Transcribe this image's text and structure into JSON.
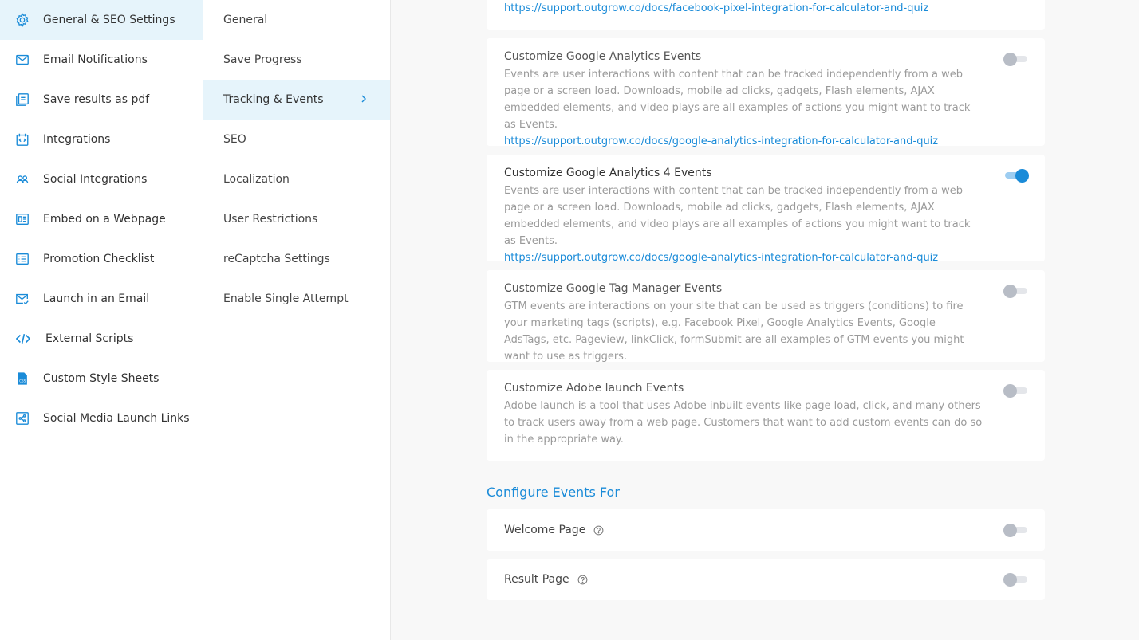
{
  "sidebar": {
    "items": [
      {
        "label": "General & SEO Settings",
        "icon": "gear-icon"
      },
      {
        "label": "Email Notifications",
        "icon": "envelope-icon"
      },
      {
        "label": "Save results as pdf",
        "icon": "pdf-icon"
      },
      {
        "label": "Integrations",
        "icon": "integrations-icon"
      },
      {
        "label": "Social Integrations",
        "icon": "users-icon"
      },
      {
        "label": "Embed on a Webpage",
        "icon": "embed-icon"
      },
      {
        "label": "Promotion Checklist",
        "icon": "checklist-icon"
      },
      {
        "label": "Launch in an Email",
        "icon": "email-check-icon"
      },
      {
        "label": "External Scripts",
        "icon": "code-icon"
      },
      {
        "label": "Custom Style Sheets",
        "icon": "css-file-icon"
      },
      {
        "label": "Social Media Launch Links",
        "icon": "share-icon"
      }
    ]
  },
  "submenu": {
    "items": [
      {
        "label": "General"
      },
      {
        "label": "Save Progress"
      },
      {
        "label": "Tracking & Events"
      },
      {
        "label": "SEO"
      },
      {
        "label": "Localization"
      },
      {
        "label": "User Restrictions"
      },
      {
        "label": "reCaptcha Settings"
      },
      {
        "label": "Enable Single Attempt"
      }
    ]
  },
  "main": {
    "top_link": "https://support.outgrow.co/docs/facebook-pixel-integration-for-calculator-and-quiz",
    "cards": [
      {
        "title": "Customize Google Analytics Events",
        "desc": "Events are user interactions with content that can be tracked independently from a web page or a screen load. Downloads, mobile ad clicks, gadgets, Flash elements, AJAX embedded elements, and video plays are all examples of actions you might want to track as Events.",
        "link": "https://support.outgrow.co/docs/google-analytics-integration-for-calculator-and-quiz",
        "enabled": false
      },
      {
        "title": "Customize Google Analytics 4 Events",
        "desc": "Events are user interactions with content that can be tracked independently from a web page or a screen load. Downloads, mobile ad clicks, gadgets, Flash elements, AJAX embedded elements, and video plays are all examples of actions you might want to track as Events.",
        "link": "https://support.outgrow.co/docs/google-analytics-integration-for-calculator-and-quiz",
        "enabled": true
      },
      {
        "title": "Customize Google Tag Manager Events",
        "desc": "GTM events are interactions on your site that can be used as triggers (conditions) to fire your marketing tags (scripts), e.g. Facebook Pixel, Google Analytics Events, Google AdsTags, etc. Pageview, linkClick, formSubmit are all examples of GTM events you might want to use as triggers.",
        "enabled": false
      },
      {
        "title": "Customize Adobe launch Events",
        "desc": "Adobe launch is a tool that uses Adobe inbuilt events like page load, click, and many others to track users away from a web page. Customers that want to add custom events can do so in the appropriate way.",
        "enabled": false
      }
    ],
    "configure": {
      "heading": "Configure Events For",
      "rows": [
        {
          "label": "Welcome Page",
          "enabled": false
        },
        {
          "label": "Result Page",
          "enabled": false
        }
      ]
    }
  },
  "colors": {
    "accent": "#1a8bd8",
    "active_bg": "#e6f4fb",
    "toggle_off": "#b8bdc6"
  }
}
